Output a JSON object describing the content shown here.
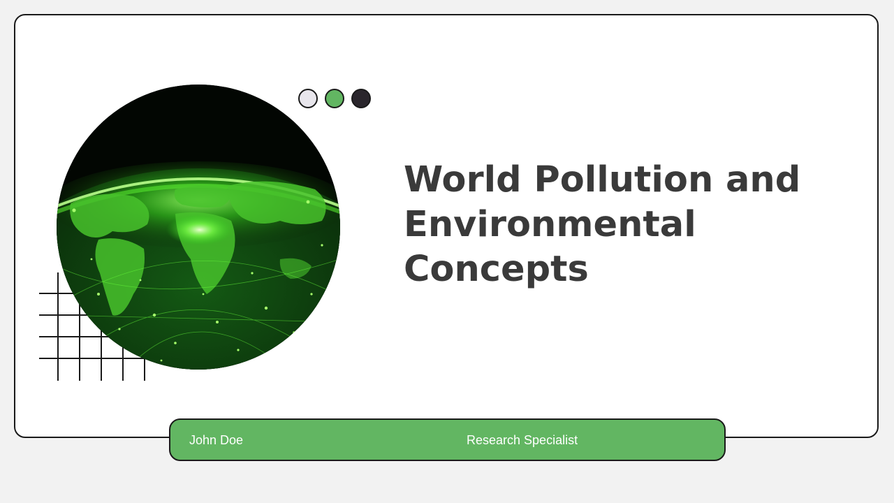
{
  "slide": {
    "title": "World Pollution and Environmental Concepts",
    "presenter_name": "John Doe",
    "presenter_role": "Research Specialist"
  },
  "decorations": {
    "dots": [
      {
        "name": "light-dot",
        "color": "#e8e6ec"
      },
      {
        "name": "green-dot",
        "color": "#62b662"
      },
      {
        "name": "dark-dot",
        "color": "#2a262c"
      }
    ],
    "globe_image": "glowing-green-earth-globe",
    "grid": "line-grid-decoration"
  },
  "colors": {
    "accent": "#62b662",
    "title_text": "#3a3a3a",
    "card_border": "#1a1a1a",
    "background": "#f2f2f2"
  }
}
